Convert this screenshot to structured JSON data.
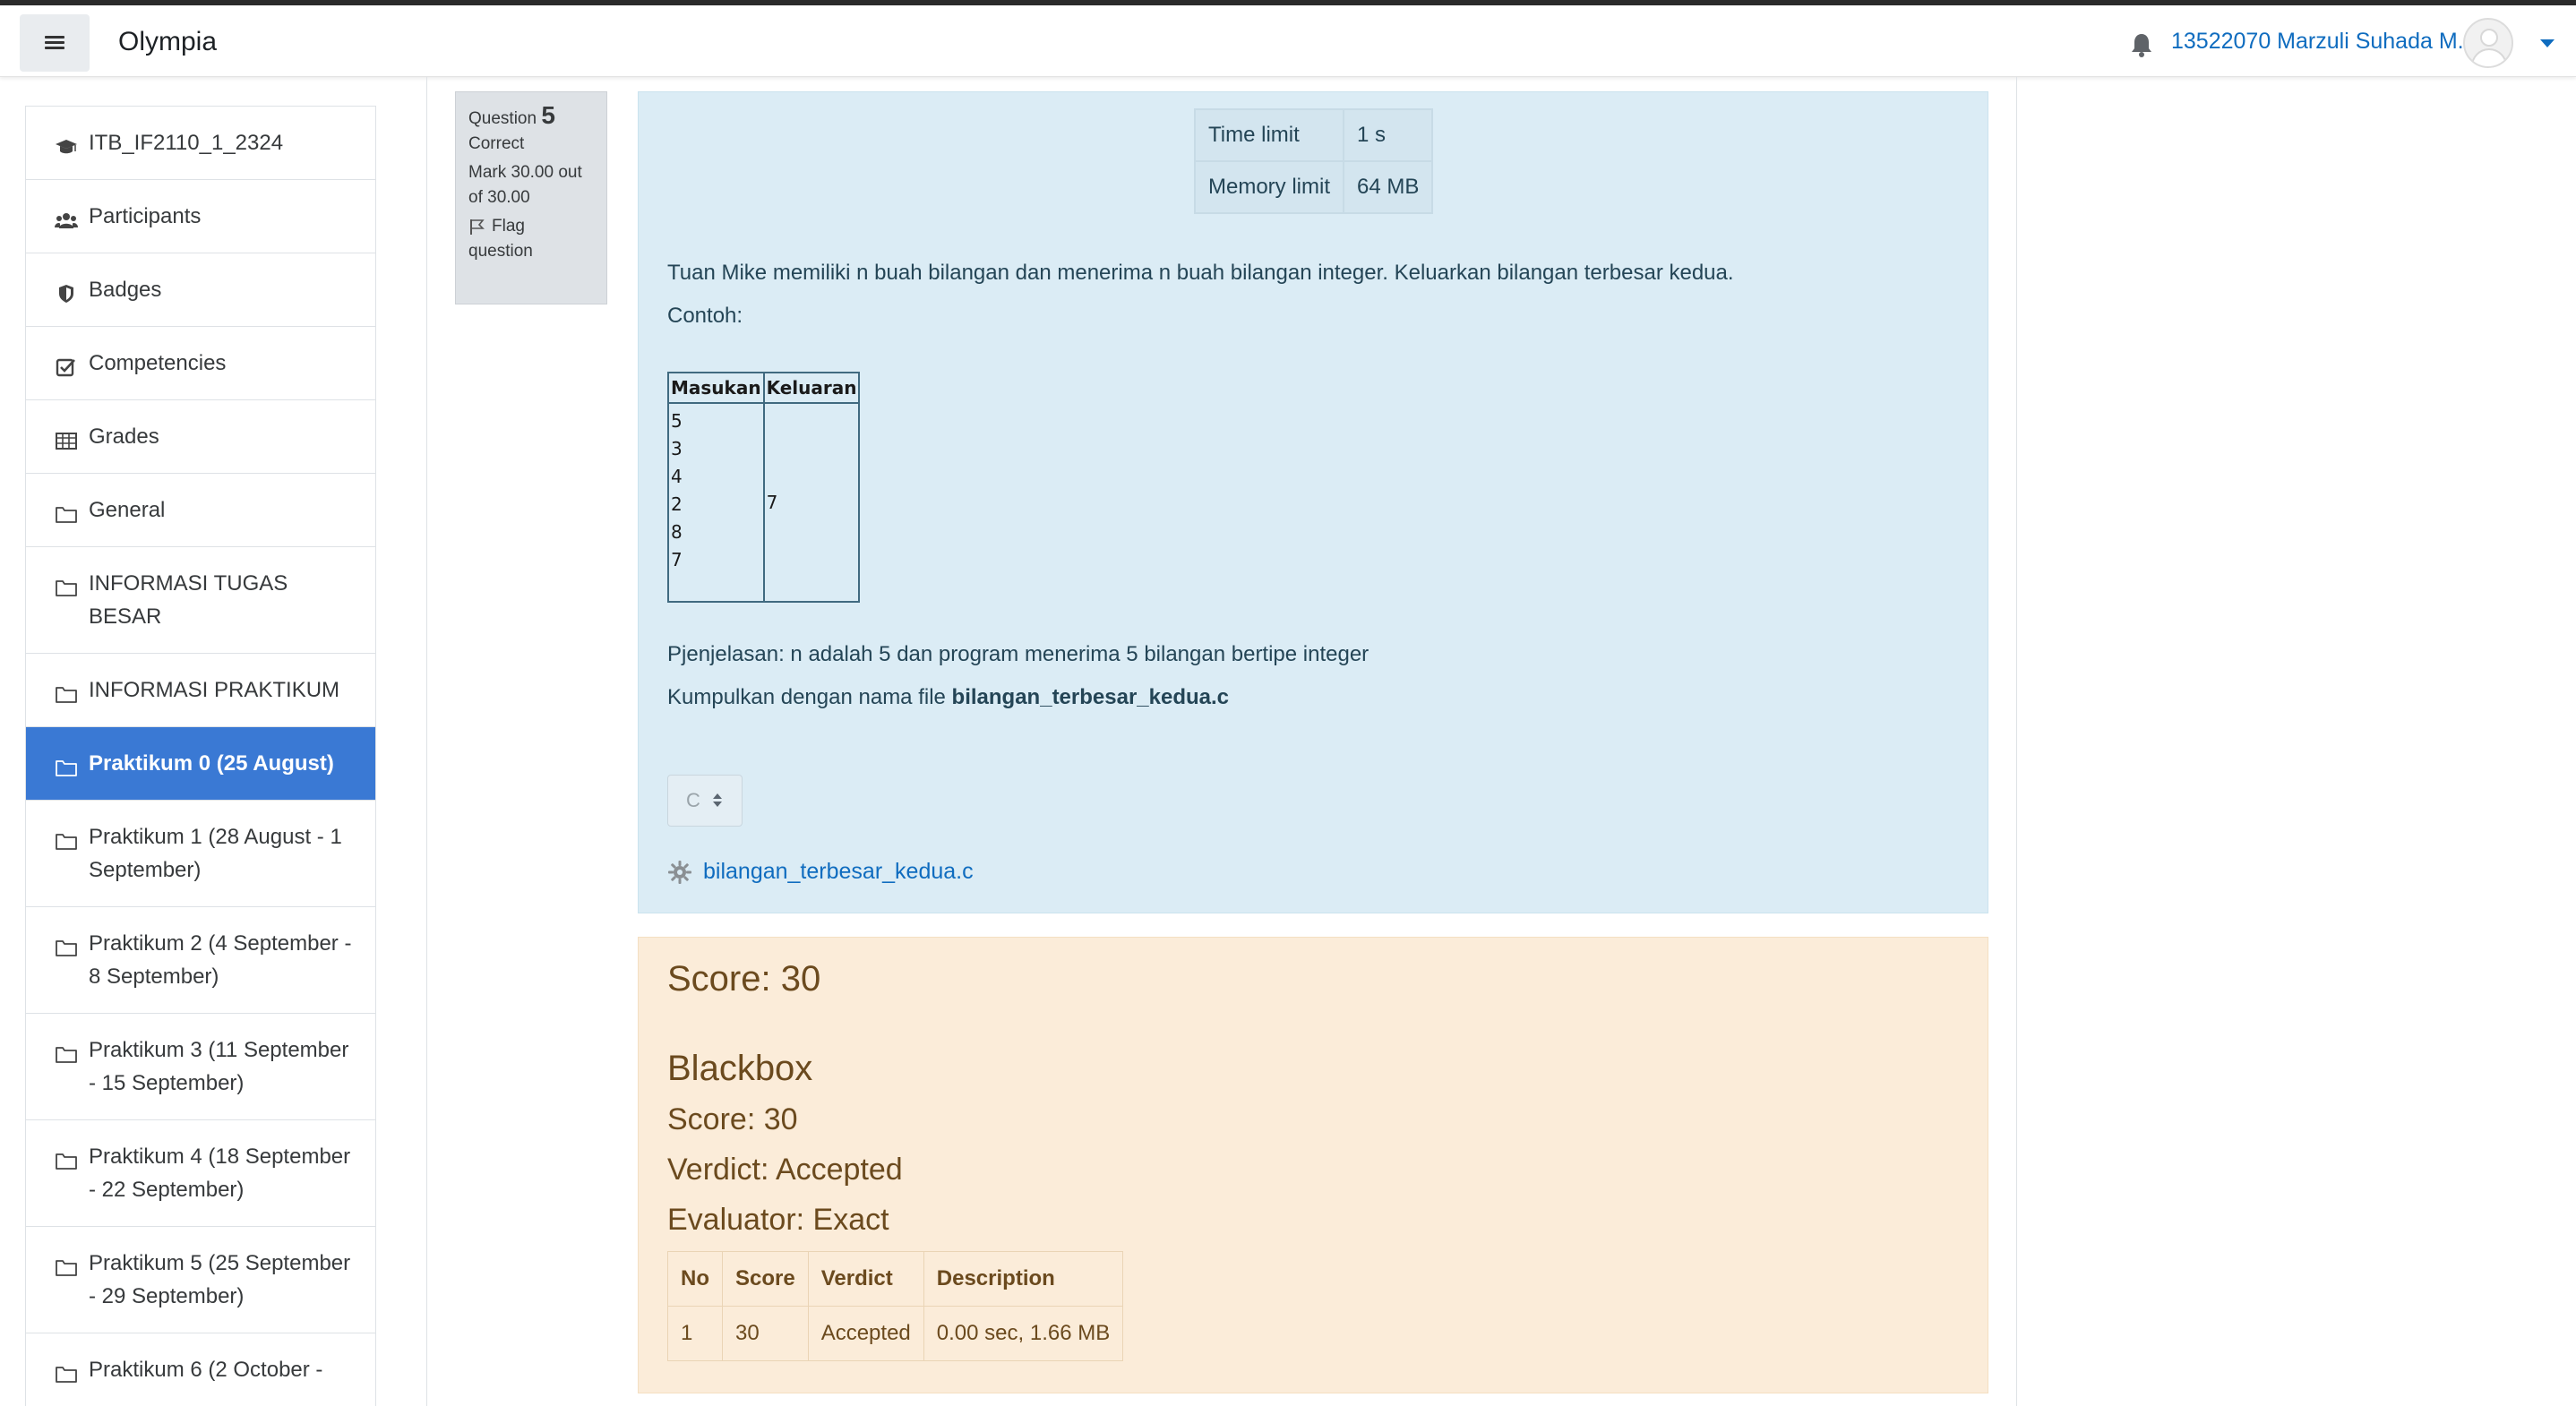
{
  "navbar": {
    "site_name": "Olympia",
    "user_name": "13522070 Marzuli Suhada M."
  },
  "sidebar": {
    "items": [
      {
        "label": "ITB_IF2110_1_2324",
        "icon": "graduation-cap-icon"
      },
      {
        "label": "Participants",
        "icon": "users-icon"
      },
      {
        "label": "Badges",
        "icon": "shield-icon"
      },
      {
        "label": "Competencies",
        "icon": "check-square-icon"
      },
      {
        "label": "Grades",
        "icon": "table-icon"
      },
      {
        "label": "General",
        "icon": "folder-icon"
      },
      {
        "label": "INFORMASI TUGAS BESAR",
        "icon": "folder-icon"
      },
      {
        "label": "INFORMASI PRAKTIKUM",
        "icon": "folder-icon"
      },
      {
        "label": "Praktikum 0 (25 August)",
        "icon": "folder-icon",
        "active": true
      },
      {
        "label": "Praktikum 1 (28 August - 1 September)",
        "icon": "folder-icon"
      },
      {
        "label": "Praktikum 2 (4 September - 8 September)",
        "icon": "folder-icon"
      },
      {
        "label": "Praktikum 3 (11 September - 15 September)",
        "icon": "folder-icon"
      },
      {
        "label": "Praktikum 4 (18 September - 22 September)",
        "icon": "folder-icon"
      },
      {
        "label": "Praktikum 5 (25 September - 29 September)",
        "icon": "folder-icon"
      },
      {
        "label": "Praktikum 6 (2 October -",
        "icon": "folder-icon"
      }
    ]
  },
  "question": {
    "label": "Question",
    "number": "5",
    "state": "Correct",
    "mark": "Mark 30.00 out of 30.00",
    "flag": "Flag question"
  },
  "limits": {
    "time_label": "Time limit",
    "time_value": "1 s",
    "memory_label": "Memory limit",
    "memory_value": "64 MB"
  },
  "problem": {
    "statement": "Tuan Mike memiliki n buah bilangan dan menerima n buah bilangan integer. Keluarkan bilangan terbesar kedua.",
    "example_label": "Contoh:",
    "table": {
      "headers": [
        "Masukan",
        "Keluaran"
      ],
      "input_lines": [
        "5",
        "3",
        "4",
        "2",
        "8",
        "7"
      ],
      "output": "7"
    },
    "explanation": "Pjenjelasan: n adalah 5 dan program menerima 5 bilangan bertipe integer",
    "submit_prefix": "Kumpulkan dengan nama file ",
    "submit_file": "bilangan_terbesar_kedua.c"
  },
  "language_select": {
    "value": "C"
  },
  "attachment": {
    "name": "bilangan_terbesar_kedua.c"
  },
  "feedback": {
    "score": "Score: 30",
    "title": "Blackbox",
    "score2": "Score: 30",
    "verdict": "Verdict: Accepted",
    "evaluator": "Evaluator: Exact",
    "table": {
      "headers": [
        "No",
        "Score",
        "Verdict",
        "Description"
      ],
      "rows": [
        [
          "1",
          "30",
          "Accepted",
          "0.00 sec, 1.66 MB"
        ]
      ]
    }
  },
  "colors": {
    "accent": "#0f6cbf",
    "active_nav": "#3a79d4",
    "question_bg": "#dbecf5",
    "feedback_bg": "#fbecd9"
  }
}
